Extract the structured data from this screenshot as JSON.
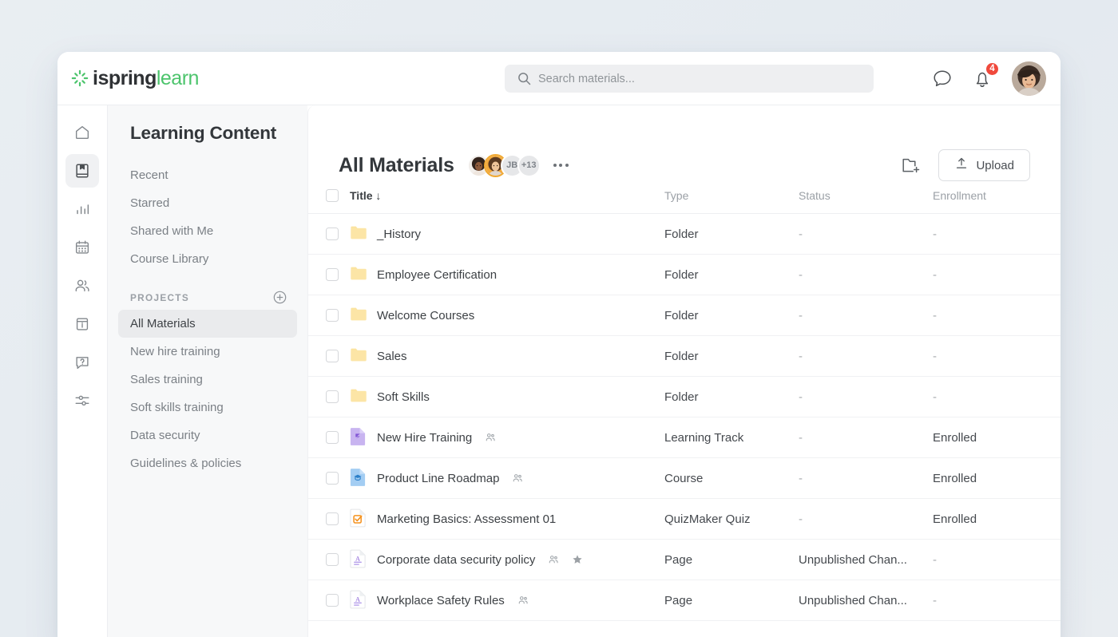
{
  "app": {
    "logo_primary": "ispring",
    "logo_accent": "learn",
    "accent_color": "#4cc46c",
    "badge_color": "#f0493c"
  },
  "header": {
    "search_placeholder": "Search materials...",
    "search_value": "",
    "search_icon": "search-icon",
    "chat_icon": "chat-bubble-icon",
    "bell_icon": "bell-icon",
    "notification_count": "4",
    "avatar": "user-avatar"
  },
  "rail": {
    "items": [
      {
        "icon": "home-icon",
        "active": false
      },
      {
        "icon": "book-icon",
        "active": true
      },
      {
        "icon": "bar-chart-icon",
        "active": false
      },
      {
        "icon": "calendar-icon",
        "active": false
      },
      {
        "icon": "users-icon",
        "active": false
      },
      {
        "icon": "info-box-icon",
        "active": false
      },
      {
        "icon": "help-chat-icon",
        "active": false
      },
      {
        "icon": "sliders-icon",
        "active": false
      }
    ]
  },
  "sidebar": {
    "title": "Learning Content",
    "links": [
      {
        "label": "Recent"
      },
      {
        "label": "Starred"
      },
      {
        "label": "Shared with Me"
      },
      {
        "label": "Course Library"
      }
    ],
    "section_label": "PROJECTS",
    "add_icon": "plus-circle-icon",
    "projects": [
      {
        "label": "All Materials",
        "active": true
      },
      {
        "label": "New hire training",
        "active": false
      },
      {
        "label": "Sales training",
        "active": false
      },
      {
        "label": "Soft skills training",
        "active": false
      },
      {
        "label": "Data security",
        "active": false
      },
      {
        "label": "Guidelines & policies",
        "active": false
      }
    ]
  },
  "content": {
    "title": "All Materials",
    "collaborators": [
      {
        "type": "photo",
        "label": ""
      },
      {
        "type": "photo",
        "label": ""
      },
      {
        "type": "initials",
        "label": "JB"
      },
      {
        "type": "count",
        "label": "+13"
      }
    ],
    "more_icon": "ellipsis-icon",
    "new_folder_icon": "new-folder-icon",
    "upload_label": "Upload",
    "upload_icon": "upload-icon"
  },
  "table": {
    "columns": [
      {
        "key": "title",
        "label": "Title",
        "sort_icon": "↓"
      },
      {
        "key": "type",
        "label": "Type"
      },
      {
        "key": "status",
        "label": "Status"
      },
      {
        "key": "enrollment",
        "label": "Enrollment"
      }
    ],
    "rows": [
      {
        "icon": "folder-icon",
        "title": "_History",
        "shared": false,
        "starred": false,
        "type": "Folder",
        "status": "-",
        "enrollment": "-"
      },
      {
        "icon": "folder-icon",
        "title": "Employee Certification",
        "shared": false,
        "starred": false,
        "type": "Folder",
        "status": "-",
        "enrollment": "-"
      },
      {
        "icon": "folder-icon",
        "title": "Welcome Courses",
        "shared": false,
        "starred": false,
        "type": "Folder",
        "status": "-",
        "enrollment": "-"
      },
      {
        "icon": "folder-icon",
        "title": "Sales",
        "shared": false,
        "starred": false,
        "type": "Folder",
        "status": "-",
        "enrollment": "-"
      },
      {
        "icon": "folder-icon",
        "title": "Soft Skills",
        "shared": false,
        "starred": false,
        "type": "Folder",
        "status": "-",
        "enrollment": "-"
      },
      {
        "icon": "track-icon",
        "title": "New Hire Training",
        "shared": true,
        "starred": false,
        "type": "Learning Track",
        "status": "-",
        "enrollment": "Enrolled"
      },
      {
        "icon": "course-icon",
        "title": "Product Line Roadmap",
        "shared": true,
        "starred": false,
        "type": "Course",
        "status": "-",
        "enrollment": "Enrolled"
      },
      {
        "icon": "quiz-icon",
        "title": "Marketing Basics: Assessment 01",
        "shared": false,
        "starred": false,
        "type": "QuizMaker Quiz",
        "status": "-",
        "enrollment": "Enrolled"
      },
      {
        "icon": "page-icon",
        "title": "Corporate data security policy",
        "shared": true,
        "starred": true,
        "type": "Page",
        "status": "Unpublished Chan...",
        "enrollment": "-"
      },
      {
        "icon": "page-icon",
        "title": "Workplace Safety Rules",
        "shared": true,
        "starred": false,
        "type": "Page",
        "status": "Unpublished Chan...",
        "enrollment": "-"
      }
    ]
  }
}
